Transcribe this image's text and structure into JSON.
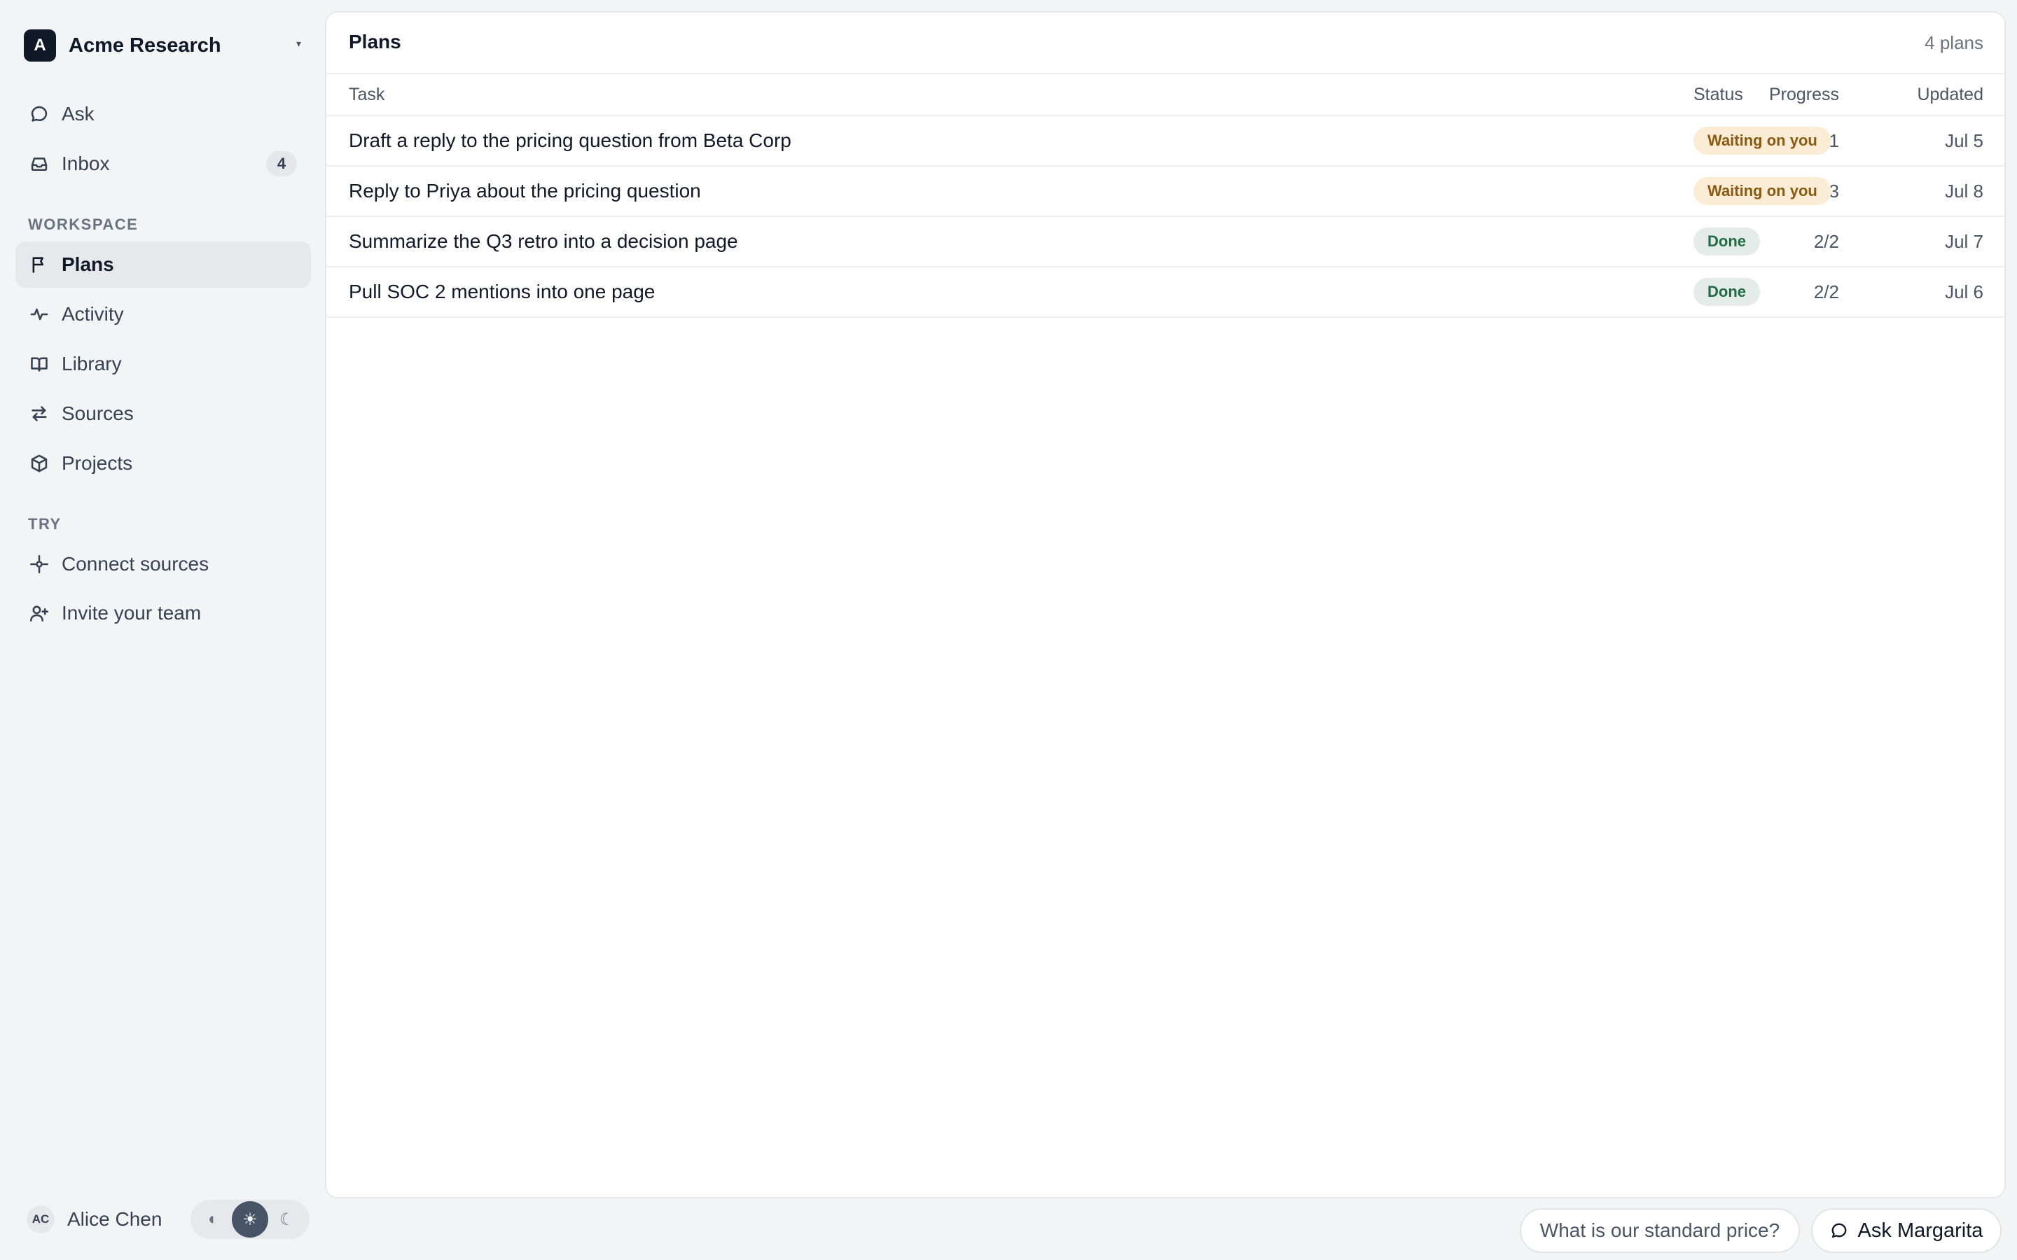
{
  "org": {
    "initial": "A",
    "name": "Acme Research",
    "caret": "▾"
  },
  "nav": {
    "ask": "Ask",
    "inbox": "Inbox",
    "inbox_count": "4",
    "workspace_label": "WORKSPACE",
    "plans": "Plans",
    "activity": "Activity",
    "library": "Library",
    "sources": "Sources",
    "projects": "Projects",
    "try_label": "TRY",
    "connect_sources": "Connect sources",
    "invite_team": "Invite your team"
  },
  "user": {
    "initials": "AC",
    "name": "Alice Chen"
  },
  "theme": {
    "system": "◐",
    "light": "☀",
    "dark": "☾"
  },
  "main": {
    "title": "Plans",
    "count": "4 plans",
    "columns": {
      "task": "Task",
      "progress": "Progress",
      "status": "Status",
      "updated": "Updated"
    },
    "rows": [
      {
        "task": "Draft a reply to the pricing question from Beta Corp",
        "progress": "0/1",
        "status": "Waiting on you",
        "updated": "Jul 5"
      },
      {
        "task": "Reply to Priya about the pricing question",
        "progress": "2/3",
        "status": "Waiting on you",
        "updated": "Jul 8"
      },
      {
        "task": "Summarize the Q3 retro into a decision page",
        "progress": "2/2",
        "status": "Done",
        "updated": "Jul 7"
      },
      {
        "task": "Pull SOC 2 mentions into one page",
        "progress": "2/2",
        "status": "Done",
        "updated": "Jul 6"
      }
    ]
  },
  "footer": {
    "suggestion": "What is our standard price?",
    "ask_button": "Ask Margarita"
  },
  "colors": {
    "accent": "#111827",
    "waiting_bg": "#fbedd5",
    "waiting_fg": "#8a5a12",
    "done_bg": "#e5ebe8",
    "done_fg": "#1f6b44"
  }
}
